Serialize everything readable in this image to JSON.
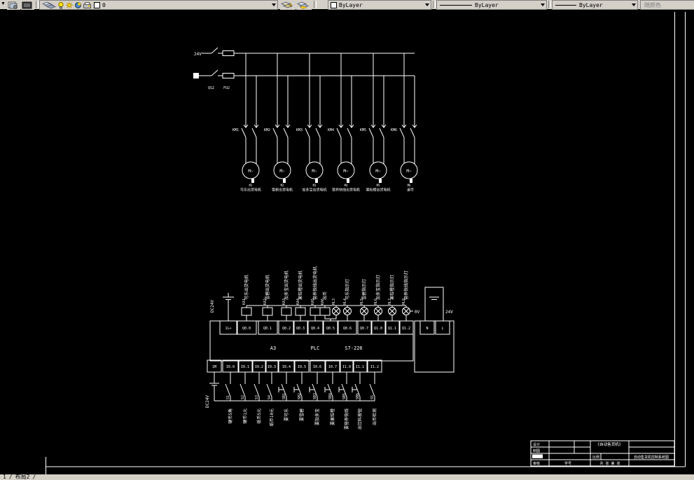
{
  "toolbar": {
    "layer_combo": {
      "layer_name": "0"
    },
    "color_combo": {
      "value": "ByLayer"
    },
    "linetype_combo": {
      "value": "ByLayer"
    },
    "lineweight_combo": {
      "value": "ByLayer"
    },
    "plotstyle_combo": {
      "value": "随颜色"
    }
  },
  "layout_tabs": {
    "tab1": "1",
    "tab2": "布局2",
    "divider": "/"
  },
  "power_circuit": {
    "supply_label": "24V",
    "switch_id": "QS2",
    "fuse_id": "FU2",
    "motor_symbol": "M~",
    "branches": [
      {
        "contactor": "KM1",
        "motor_id": "M1",
        "name": "可乐出货电机"
      },
      {
        "contactor": "KM2",
        "motor_id": "M2",
        "name": "雪碧出货电机"
      },
      {
        "contactor": "KM3",
        "motor_id": "M3",
        "name": "加多宝出货电机"
      },
      {
        "contactor": "KM4",
        "motor_id": "M4",
        "name": "营养快线出货电机"
      },
      {
        "contactor": "KM5",
        "motor_id": "M5",
        "name": "果粒橙出货电机"
      },
      {
        "contactor": "KM6",
        "motor_id": "M6",
        "name": "退币"
      }
    ]
  },
  "plc": {
    "frame_label": "A3",
    "device_label": "PLC",
    "model_label": "S7-226",
    "outputs": {
      "common_label": "DC24V",
      "zero_volt_label": "0V",
      "supply_label": "24V",
      "neutral_terminal": "N",
      "line_terminal": "L",
      "terminals": [
        "1L+",
        "Q0.0",
        "Q0.1",
        "Q0.2",
        "Q0.3",
        "Q0.4",
        "Q0.5",
        "Q0.6",
        "Q0.7",
        "Q1.0",
        "Q1.1",
        "Q1.2"
      ],
      "devices": [
        {
          "id": "KA1",
          "label": "可乐出货电机"
        },
        {
          "id": "KA2",
          "label": "雪碧出货电机"
        },
        {
          "id": "KA3",
          "label": "加多宝出货电机"
        },
        {
          "id": "KA4",
          "label": "果粒橙出货电机"
        },
        {
          "id": "KA5",
          "label": "营养快线出货电机"
        },
        {
          "id": "KA6",
          "label": "出币"
        },
        {
          "id": "HL3",
          "label": ""
        },
        {
          "id": "HL4",
          "label": "可乐指示灯"
        },
        {
          "id": "HL5",
          "label": "雪碧指示灯"
        },
        {
          "id": "HL6",
          "label": "加多宝指示灯"
        },
        {
          "id": "HL7",
          "label": "果粒橙指示灯"
        },
        {
          "id": "HL8",
          "label": "营养快线指示灯"
        }
      ]
    },
    "inputs": {
      "common_label": "DC24V",
      "terminals": [
        "1M",
        "I0.0",
        "I0.1",
        "I0.2",
        "I0.3",
        "I0.4",
        "I0.5",
        "I0.6",
        "I0.7",
        "I1.0",
        "I1.1",
        "I1.2"
      ],
      "switches": [
        {
          "id": "S1",
          "label": "硬币5角"
        },
        {
          "id": "S2",
          "label": "硬币1元"
        },
        {
          "id": "S3",
          "label": "纸币5元"
        },
        {
          "id": "S4",
          "label": "纸币10元"
        },
        {
          "id": "SB1",
          "label": "要可乐"
        },
        {
          "id": "SB2",
          "label": "要雪碧"
        },
        {
          "id": "SB3",
          "label": "要加多宝"
        },
        {
          "id": "SB4",
          "label": "要果粒橙"
        },
        {
          "id": "SB5",
          "label": "要营养快线"
        },
        {
          "id": "SB6",
          "label": "出饮料按钮"
        },
        {
          "id": "S5",
          "label": "出币检测"
        }
      ]
    }
  },
  "title_block": {
    "design_label": "设计",
    "draft_label": "制图",
    "check_label": "审核",
    "id_label": "学号",
    "doc_name": "《自动售货机》",
    "scale_label": "比例",
    "drawing_title": "自动售货机控制系统图",
    "sheet_label": "共 张 第 张"
  }
}
